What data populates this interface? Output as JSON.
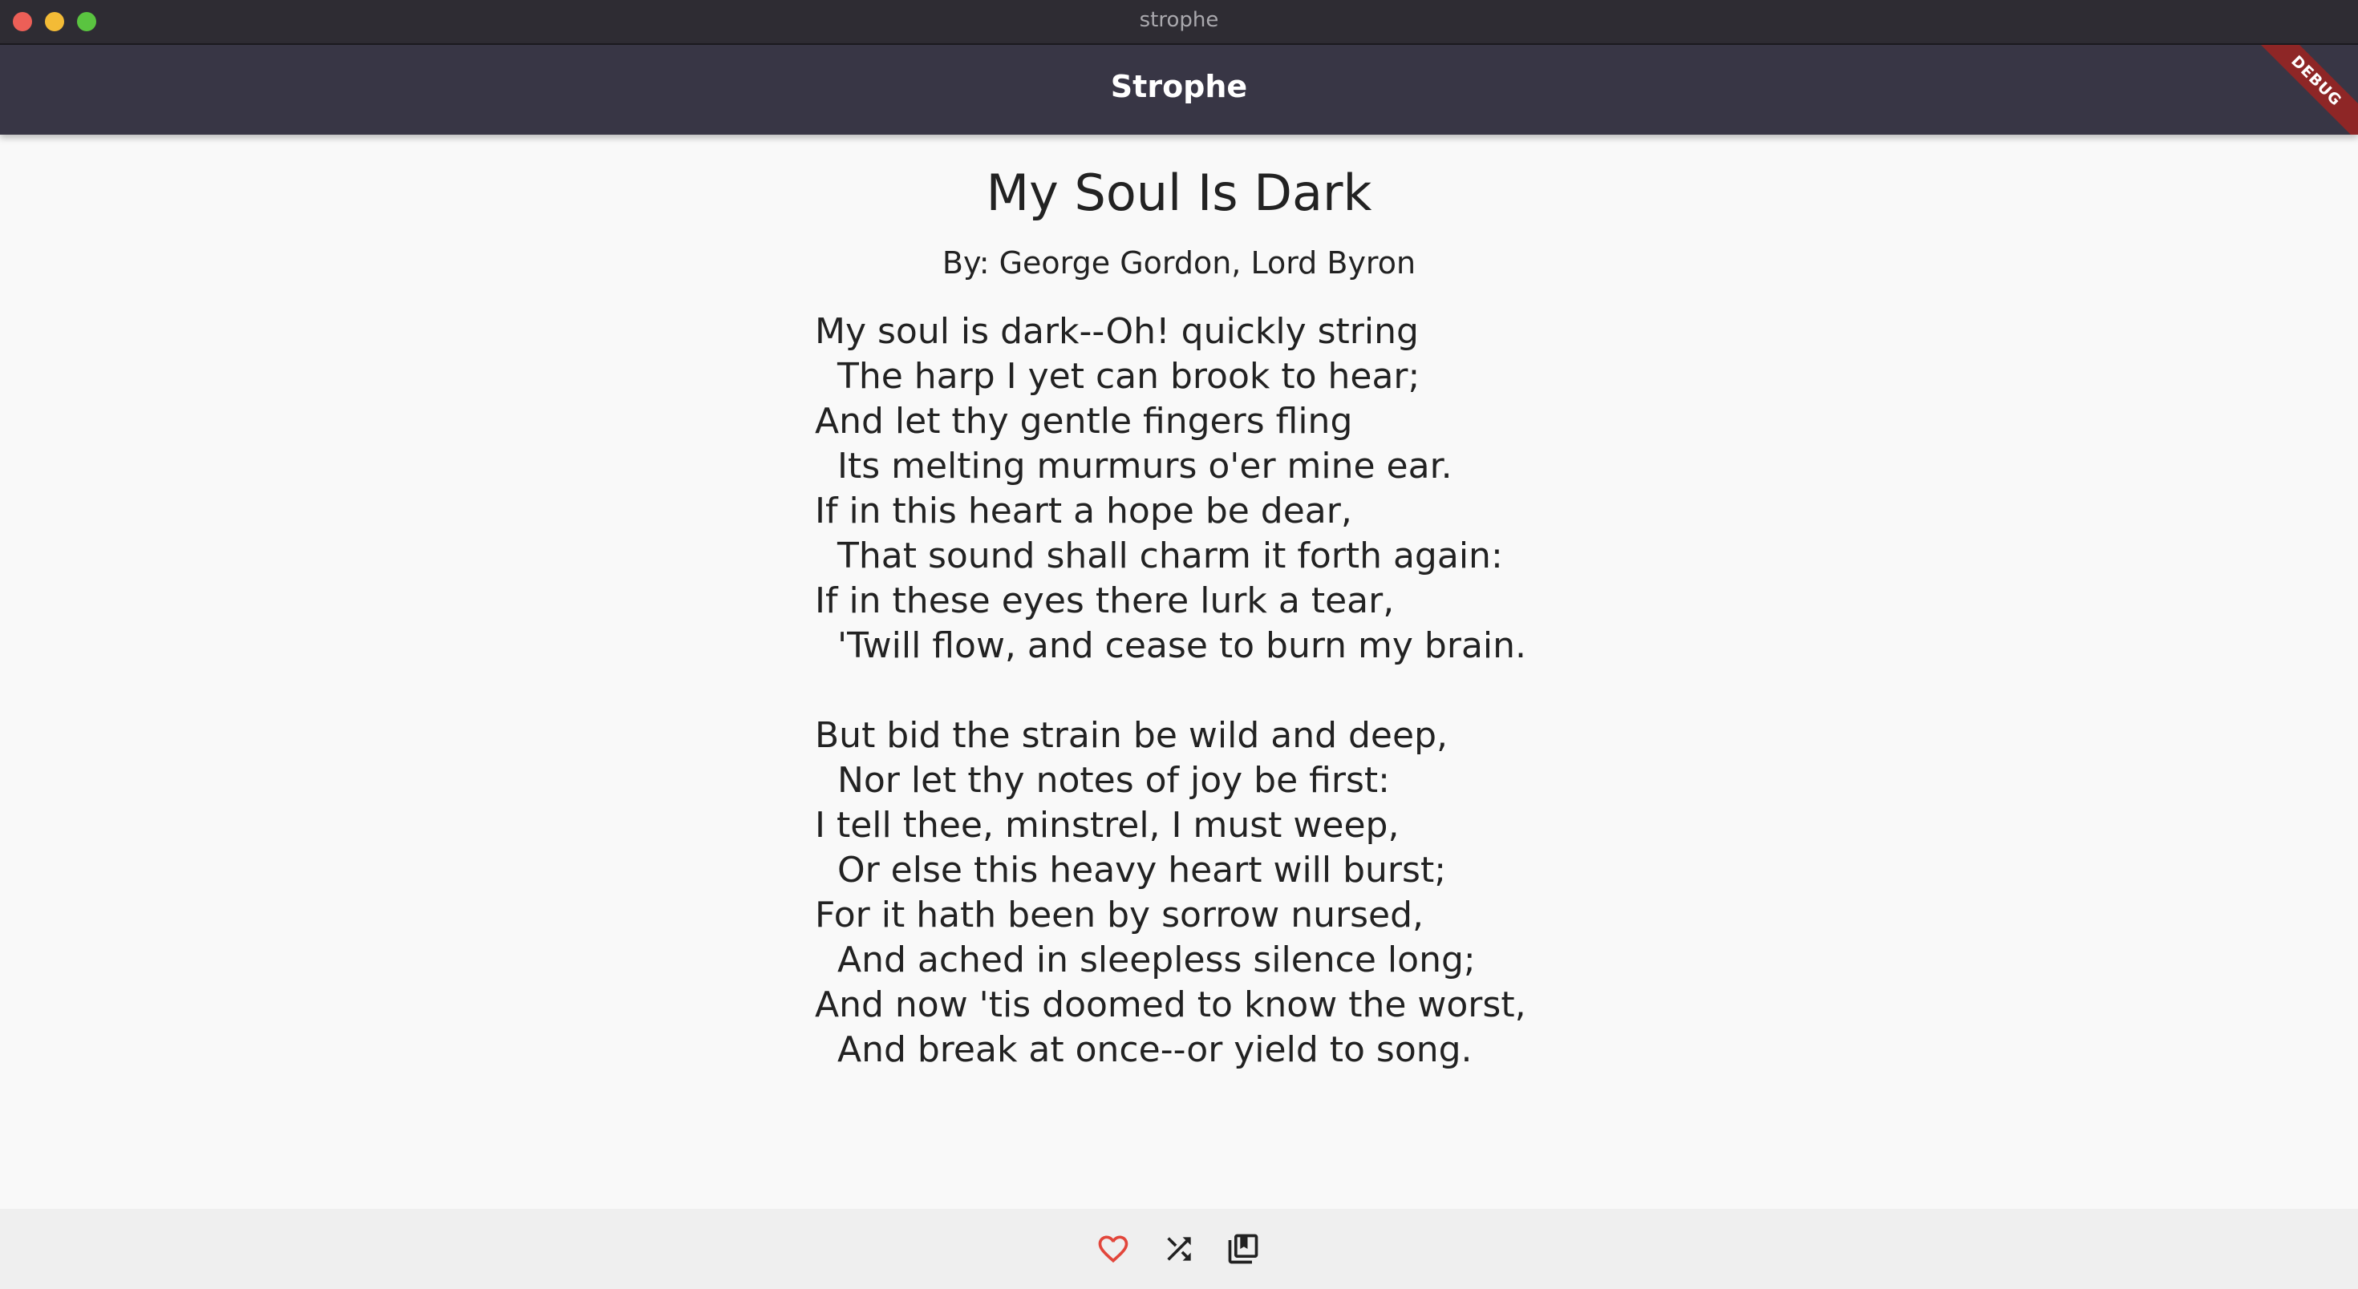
{
  "window": {
    "title": "strophe"
  },
  "appbar": {
    "title": "Strophe",
    "debug_label": "DEBUG"
  },
  "poem": {
    "title": "My Soul Is Dark",
    "author": "By: George Gordon, Lord Byron",
    "lines": [
      "My soul is dark--Oh! quickly string",
      "  The harp I yet can brook to hear;",
      "And let thy gentle fingers fling",
      "  Its melting murmurs o'er mine ear.",
      "If in this heart a hope be dear,",
      "  That sound shall charm it forth again:",
      "If in these eyes there lurk a tear,",
      "  'Twill flow, and cease to burn my brain.",
      "",
      "But bid the strain be wild and deep,",
      "  Nor let thy notes of joy be first:",
      "I tell thee, minstrel, I must weep,",
      "  Or else this heavy heart will burst;",
      "For it hath been by sorrow nursed,",
      "  And ached in sleepless silence long;",
      "And now 'tis doomed to know the worst,",
      "  And break at once--or yield to song."
    ]
  },
  "bottombar": {
    "favorite_icon": "heart-outline-icon",
    "shuffle_icon": "shuffle-icon",
    "library_icon": "library-books-icon"
  },
  "colors": {
    "titlebar": "#2e2c33",
    "appbar": "#383645",
    "background": "#f9f9f9",
    "bottombar": "#efefef",
    "favorite": "#e2463b",
    "debug_banner": "#8e2626"
  }
}
